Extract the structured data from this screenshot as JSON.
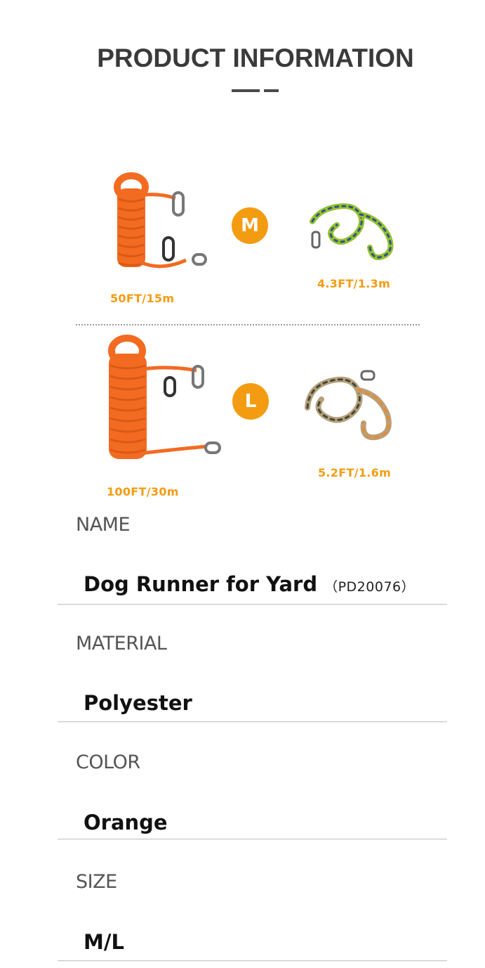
{
  "header": {
    "title": "PRODUCT INFORMATION"
  },
  "sizes": [
    {
      "badge": "M",
      "runner_length": "50FT/15m",
      "leash_length": "4.3FT/1.3m"
    },
    {
      "badge": "L",
      "runner_length": "100FT/30m",
      "leash_length": "5.2FT/1.6m"
    }
  ],
  "specs": [
    {
      "label": "NAME",
      "value": "Dog Runner for Yard",
      "code": "（PD20076）"
    },
    {
      "label": "MATERIAL",
      "value": "Polyester"
    },
    {
      "label": "COLOR",
      "value": "Orange"
    },
    {
      "label": "SIZE",
      "value": "M/L"
    }
  ],
  "colors": {
    "accent": "#f39c12",
    "rope": "#f26b21"
  }
}
